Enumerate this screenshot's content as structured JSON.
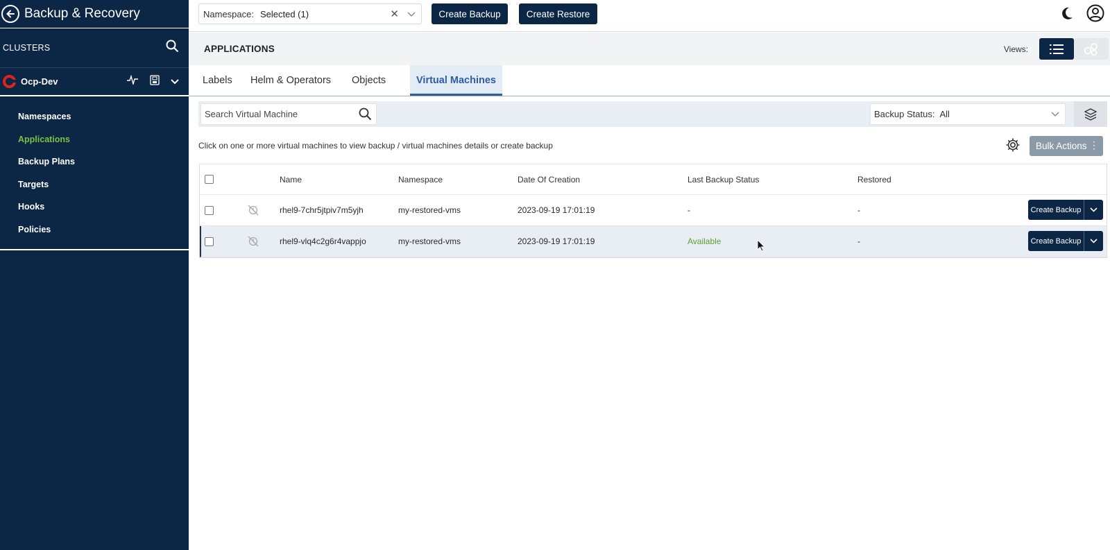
{
  "sidebar": {
    "title": "Backup & Recovery",
    "clusters_label": "CLUSTERS",
    "cluster_name": "Ocp-Dev",
    "nav": [
      {
        "label": "Namespaces",
        "active": false
      },
      {
        "label": "Applications",
        "active": true
      },
      {
        "label": "Backup Plans",
        "active": false
      },
      {
        "label": "Targets",
        "active": false
      },
      {
        "label": "Hooks",
        "active": false
      },
      {
        "label": "Policies",
        "active": false
      }
    ]
  },
  "topbar": {
    "namespace_label": "Namespace:",
    "namespace_value": "Selected (1)",
    "create_backup": "Create Backup",
    "create_restore": "Create Restore"
  },
  "header": {
    "title": "APPLICATIONS",
    "views_label": "Views:"
  },
  "tabs": [
    {
      "label": "Labels",
      "active": false
    },
    {
      "label": "Helm & Operators",
      "active": false
    },
    {
      "label": "Objects",
      "active": false
    },
    {
      "label": "Virtual Machines",
      "active": true
    }
  ],
  "filters": {
    "search_placeholder": "Search Virtual Machine",
    "backup_status_label": "Backup Status:",
    "backup_status_value": "All"
  },
  "hint": "Click on one or more virtual machines to view backup / virtual machines details or create backup",
  "bulk_actions": "Bulk Actions",
  "table": {
    "columns": [
      "Name",
      "Namespace",
      "Date Of Creation",
      "Last Backup Status",
      "Restored"
    ],
    "rows": [
      {
        "name": "rhel9-7chr5jtpiv7m5yjh",
        "namespace": "my-restored-vms",
        "created": "2023-09-19 17:01:19",
        "last_backup_status": "-",
        "restored": "-",
        "action": "Create Backup"
      },
      {
        "name": "rhel9-vlq4c2g6r4vappjo",
        "namespace": "my-restored-vms",
        "created": "2023-09-19 17:01:19",
        "last_backup_status": "Available",
        "restored": "-",
        "action": "Create Backup"
      }
    ]
  },
  "colors": {
    "sidebar_bg": "#0b2745",
    "accent_green": "#7cc243",
    "tab_active": "#2e5ea3",
    "status_available": "#5a9e2f"
  }
}
